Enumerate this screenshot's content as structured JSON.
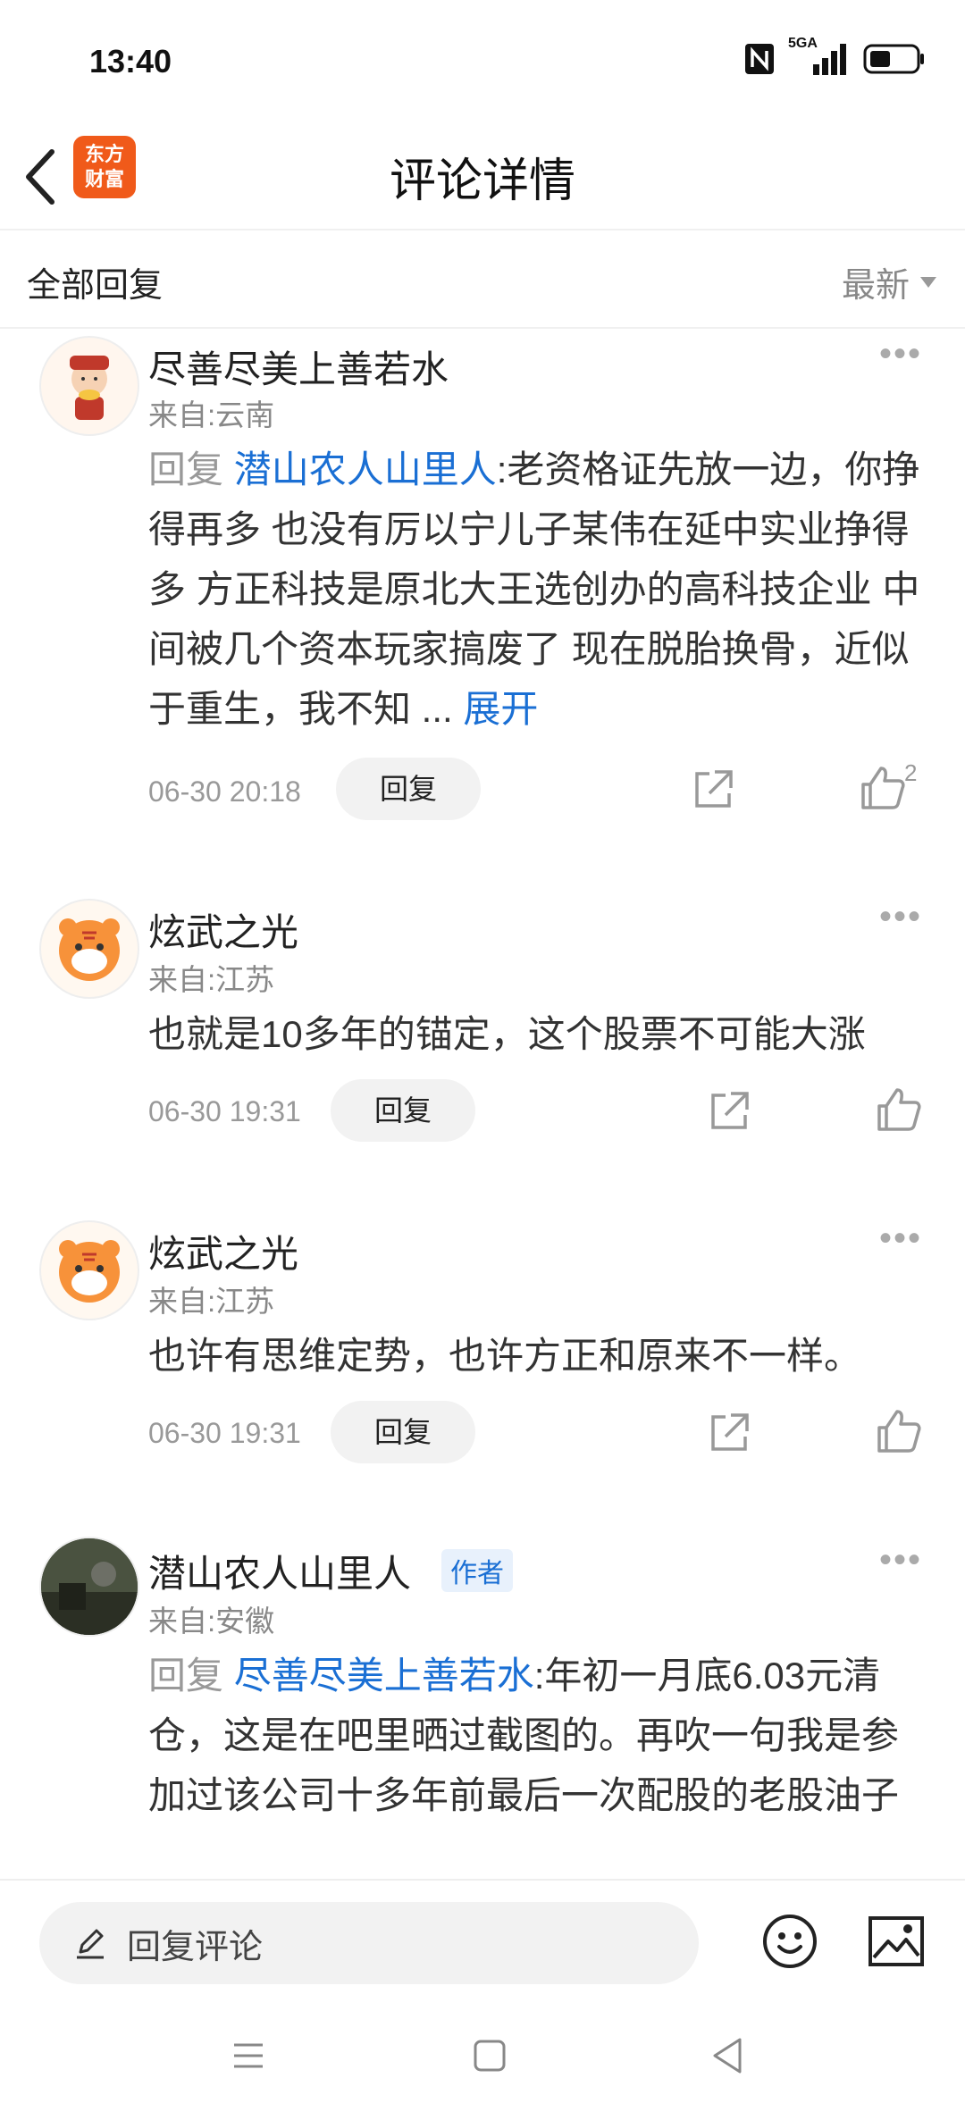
{
  "status_bar": {
    "time": "13:40",
    "network": "5GA"
  },
  "header": {
    "title": "评论详情",
    "logo_line1": "东方",
    "logo_line2": "财富"
  },
  "filter": {
    "left_label": "全部回复",
    "sort_label": "最新"
  },
  "comments": [
    {
      "name": "尽善尽美上善若水",
      "origin": "来自:云南",
      "reply_prefix": "回复",
      "reply_target": "潜山农人山里人",
      "text": ":老资格证先放一边，你挣得再多 也没有厉以宁儿子某伟在延中实业挣得多 方正科技是原北大王选创办的高科技企业 中间被几个资本玩家搞废了 现在脱胎换骨，近似于重生，我不知 ...",
      "expand": "展开",
      "time": "06-30 20:18",
      "reply_label": "回复",
      "likes": "2"
    },
    {
      "name": "炫武之光",
      "origin": "来自:江苏",
      "text": "也就是10多年的锚定，这个股票不可能大涨",
      "time": "06-30 19:31",
      "reply_label": "回复"
    },
    {
      "name": "炫武之光",
      "origin": "来自:江苏",
      "text": "也许有思维定势，也许方正和原来不一样。",
      "time": "06-30 19:31",
      "reply_label": "回复"
    },
    {
      "name": "潜山农人山里人",
      "badge": "作者",
      "origin": "来自:安徽",
      "reply_prefix": "回复",
      "reply_target": "尽善尽美上善若水",
      "text": ":年初一月底6.03元清仓，这是在吧里晒过截图的。再吹一句我是参加过该公司十多年前最后一次配股的老股油子"
    }
  ],
  "bottom": {
    "placeholder": "回复评论"
  },
  "colors": {
    "accent": "#1a6fd4",
    "brand": "#f05a1a"
  }
}
